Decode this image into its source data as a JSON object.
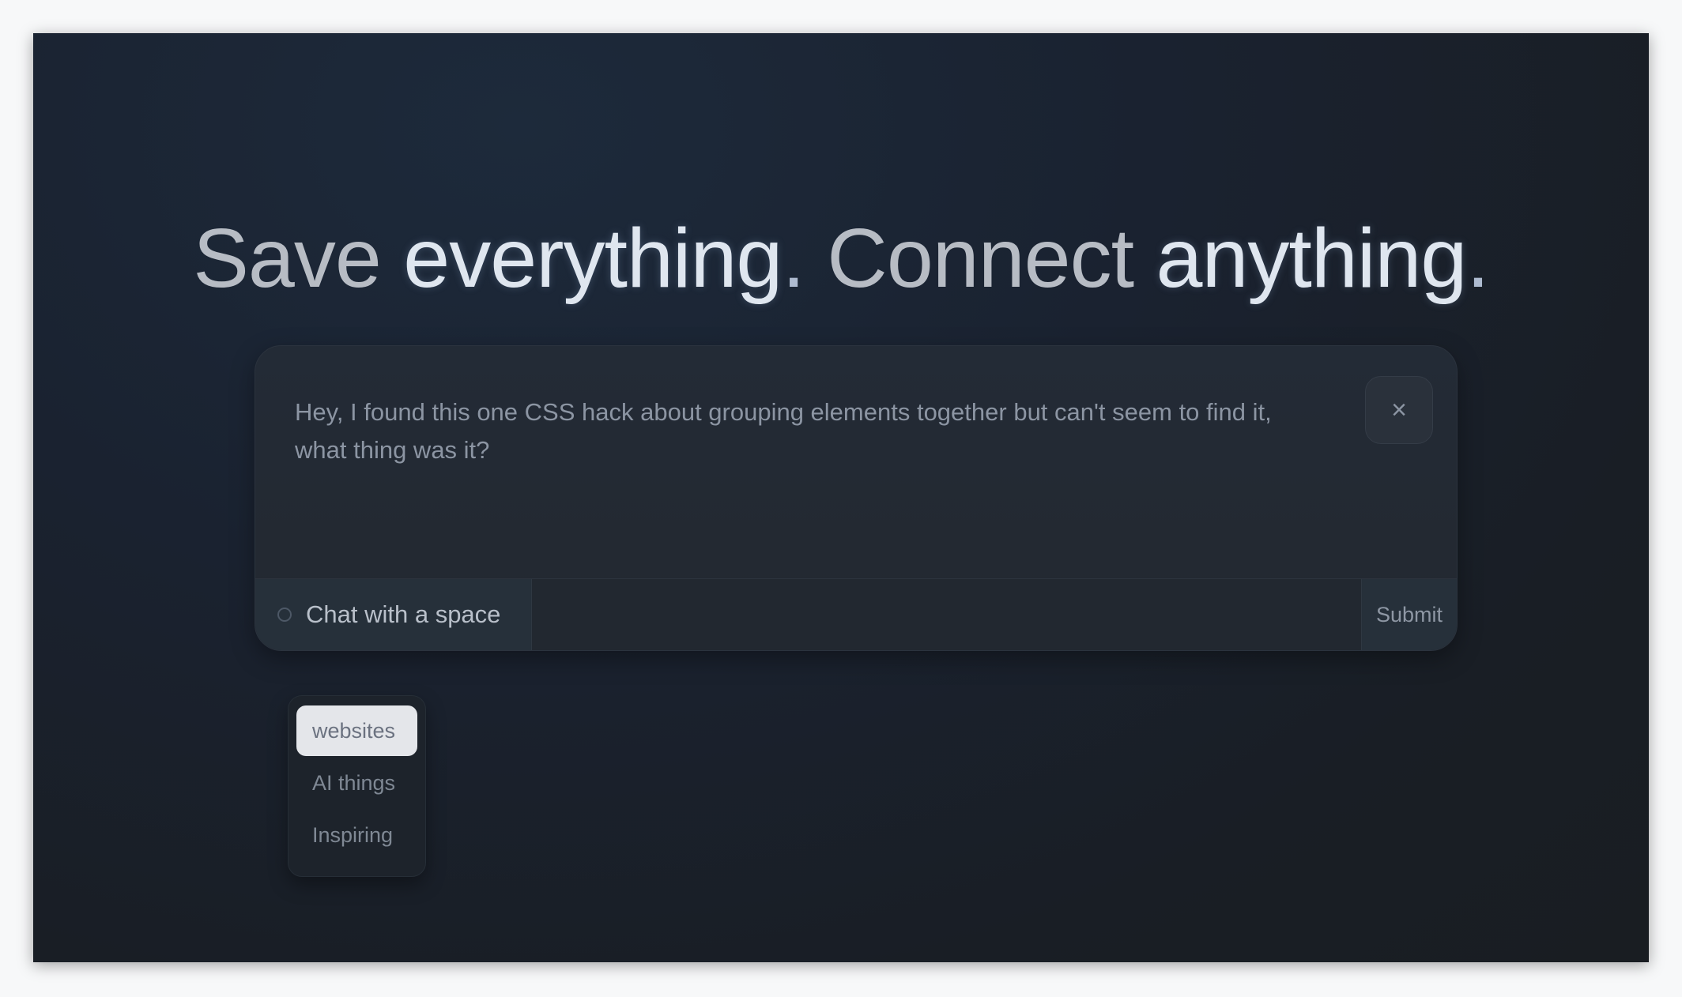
{
  "headline": {
    "part1": "Save ",
    "part2": "everything",
    "part3": ". ",
    "part4": "Connect ",
    "part5": "anything",
    "part6": "."
  },
  "composer": {
    "text": "Hey, I found this one CSS hack about grouping elements together but can't seem to find it, what thing was it?",
    "close_icon": "×",
    "chat_space_label": "Chat with a space",
    "submit_label": "Submit"
  },
  "dropdown": {
    "items": [
      {
        "label": "websites",
        "selected": true
      },
      {
        "label": "AI things",
        "selected": false
      },
      {
        "label": "Inspiring",
        "selected": false
      }
    ]
  }
}
